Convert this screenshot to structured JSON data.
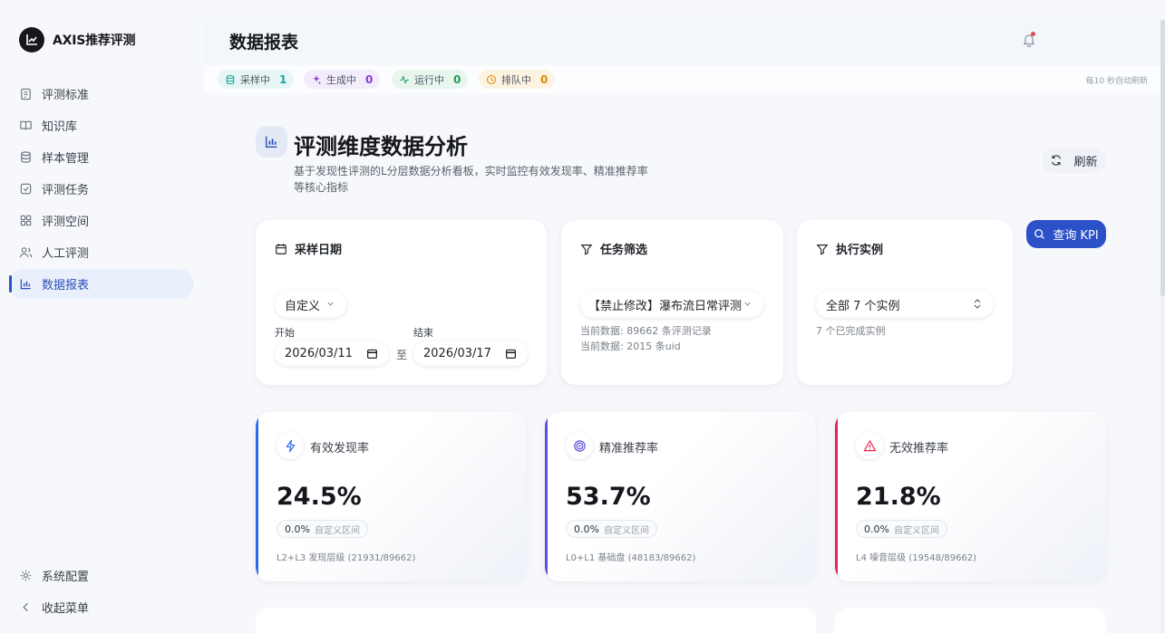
{
  "app": {
    "name": "AXIS推荐评测"
  },
  "sidebar": {
    "items": [
      {
        "label": "评测标准",
        "icon": "clipboard-icon",
        "active": false
      },
      {
        "label": "知识库",
        "icon": "book-icon",
        "active": false
      },
      {
        "label": "样本管理",
        "icon": "database-icon",
        "active": false
      },
      {
        "label": "评测任务",
        "icon": "checkbox-icon",
        "active": false
      },
      {
        "label": "评测空间",
        "icon": "grid-icon",
        "active": false
      },
      {
        "label": "人工评测",
        "icon": "users-icon",
        "active": false
      },
      {
        "label": "数据报表",
        "icon": "bar-chart-icon",
        "active": true
      }
    ],
    "bottom": [
      {
        "label": "系统配置",
        "icon": "gear-icon"
      },
      {
        "label": "收起菜单",
        "icon": "chevron-left-icon"
      }
    ]
  },
  "header": {
    "title": "数据报表"
  },
  "status": {
    "pills": [
      {
        "label": "采样中",
        "count": "1",
        "color": "#1aa39a",
        "bg": "#e7f6f5"
      },
      {
        "label": "生成中",
        "count": "0",
        "color": "#8a3fd1",
        "bg": "#f3ecfb"
      },
      {
        "label": "运行中",
        "count": "0",
        "color": "#1f9d55",
        "bg": "#e8f6ee"
      },
      {
        "label": "排队中",
        "count": "0",
        "color": "#d98a00",
        "bg": "#fdf3e2"
      }
    ],
    "auto_refresh": "每10 秒自动刷新"
  },
  "hero": {
    "title": "评测维度数据分析",
    "desc_line1": "基于发现性评测的L分层数据分析看板，实时监控有效发现率、精准推荐率",
    "desc_line2": "等核心指标",
    "refresh_label": "刷新"
  },
  "filters": {
    "date": {
      "title": "采样日期",
      "mode": "自定义",
      "start_label": "开始",
      "end_label": "结束",
      "start": "2026/03/11",
      "end": "2026/03/17",
      "to": "至"
    },
    "task": {
      "title": "任务筛选",
      "selected": "【禁止修改】瀑布流日常评测",
      "meta1": "当前数据: 89662 条评测记录",
      "meta2": "当前数据: 2015 条uid"
    },
    "instance": {
      "title": "执行实例",
      "selected": "全部 7 个实例",
      "meta": "7 个已完成实例"
    },
    "query_label": "查询 KPI"
  },
  "kpis": [
    {
      "label": "有效发现率",
      "value": "24.5%",
      "chip": "0.0%",
      "chip_sub": "自定义区间",
      "foot": "L2+L3 发现层级 (21931/89662)",
      "color": "#2c6bef",
      "icon": "bolt-icon"
    },
    {
      "label": "精准推荐率",
      "value": "53.7%",
      "chip": "0.0%",
      "chip_sub": "自定义区间",
      "foot": "L0+L1 基础盘 (48183/89662)",
      "color": "#5b4fe0",
      "icon": "target-icon"
    },
    {
      "label": "无效推荐率",
      "value": "21.8%",
      "chip": "0.0%",
      "chip_sub": "自定义区间",
      "foot": "L4 噪音层级 (19548/89662)",
      "color": "#e5244f",
      "icon": "warning-icon"
    }
  ]
}
